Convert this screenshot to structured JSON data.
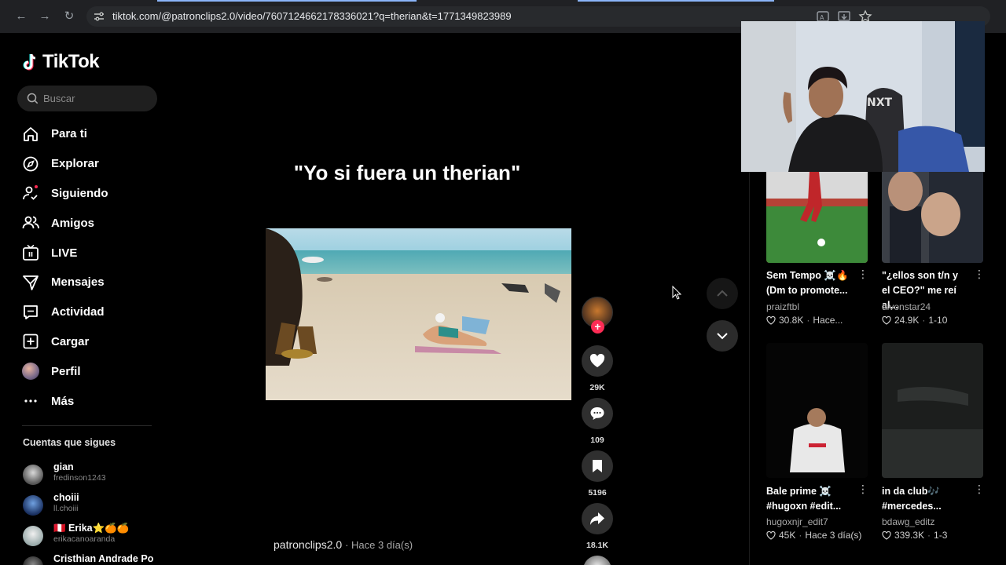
{
  "browser": {
    "url": "tiktok.com/@patronclips2.0/video/7607124662178336021?q=therian&t=1771349823989"
  },
  "sidebar": {
    "brand": "TikTok",
    "search_placeholder": "Buscar",
    "nav": [
      {
        "label": "Para ti",
        "icon": "home-icon"
      },
      {
        "label": "Explorar",
        "icon": "compass-icon"
      },
      {
        "label": "Siguiendo",
        "icon": "following-icon"
      },
      {
        "label": "Amigos",
        "icon": "friends-icon"
      },
      {
        "label": "LIVE",
        "icon": "live-icon"
      },
      {
        "label": "Mensajes",
        "icon": "messages-icon"
      },
      {
        "label": "Actividad",
        "icon": "activity-icon"
      },
      {
        "label": "Cargar",
        "icon": "upload-icon"
      },
      {
        "label": "Perfil",
        "icon": "profile-avatar"
      },
      {
        "label": "Más",
        "icon": "more-icon"
      }
    ],
    "following_title": "Cuentas que sigues",
    "accounts": [
      {
        "name": "gian",
        "username": "fredinson1243"
      },
      {
        "name": "choiii",
        "username": "ll.choiii"
      },
      {
        "name": "🇵🇪 Erika⭐🍊🍊",
        "username": "erikacanoaranda"
      },
      {
        "name": "Cristhian Andrade Po",
        "username": ""
      }
    ]
  },
  "video": {
    "caption_overlay": "\"Yo si fuera un therian\"",
    "author": "patronclips2.0",
    "posted": "Hace 3 día(s)",
    "likes": "29K",
    "comments": "109",
    "saves": "5196",
    "shares": "18.1K"
  },
  "related": [
    {
      "title": "Sem Tempo ☠️🔥 (Dm to promote...",
      "user": "praizftbl",
      "likes": "30.8K",
      "date": "Hace..."
    },
    {
      "title": "\"¿ellos son t/n y el CEO?\" me reí al...",
      "user": "divonstar24",
      "likes": "24.9K",
      "date": "1-10"
    },
    {
      "title": "Bale prime ☠️ #hugoxn #edit...",
      "user": "hugoxnjr_edit7",
      "likes": "45K",
      "date": "Hace 3 día(s)"
    },
    {
      "title": "in da club🎶 #mercedes...",
      "user": "bdawg_editz",
      "likes": "339.3K",
      "date": "1-3"
    }
  ],
  "colors": {
    "accent": "#fe2c55",
    "background": "#000000"
  }
}
